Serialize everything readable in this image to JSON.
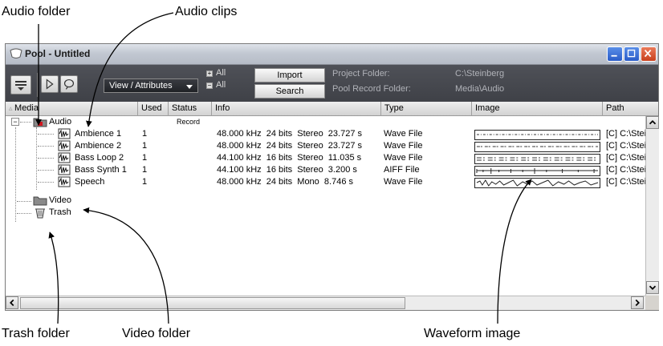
{
  "callouts": {
    "audio_folder": "Audio folder",
    "audio_clips": "Audio clips",
    "trash_folder": "Trash folder",
    "video_folder": "Video folder",
    "waveform_image": "Waveform image"
  },
  "window": {
    "title": "Pool - Untitled",
    "toolbar": {
      "view_dropdown": "View / Attributes",
      "all_1": "All",
      "all_2": "All",
      "import": "Import",
      "search": "Search",
      "project_folder_label": "Project Folder:",
      "project_folder_value": "C:\\Steinberg",
      "pool_record_label": "Pool Record Folder:",
      "pool_record_value": "Media\\Audio"
    },
    "columns": {
      "media": "Media",
      "used": "Used",
      "status": "Status",
      "info": "Info",
      "type": "Type",
      "image": "Image",
      "path": "Path"
    },
    "audio_folder": {
      "name": "Audio",
      "status": "Record"
    },
    "clips": [
      {
        "name": "Ambience 1",
        "used": "1",
        "info": "48.000 kHz  24 bits  Stereo  23.727 s",
        "type": "Wave File",
        "path": "[C] C:\\Stei"
      },
      {
        "name": "Ambience 2",
        "used": "1",
        "info": "48.000 kHz  24 bits  Stereo  23.727 s",
        "type": "Wave File",
        "path": "[C] C:\\Stei"
      },
      {
        "name": "Bass Loop 2",
        "used": "1",
        "info": "44.100 kHz  16 bits  Stereo  11.035 s",
        "type": "Wave File",
        "path": "[C] C:\\Stei"
      },
      {
        "name": "Bass Synth 1",
        "used": "1",
        "info": "44.100 kHz  16 bits  Stereo  3.200 s",
        "type": "AIFF File",
        "path": "[C] C:\\Stei"
      },
      {
        "name": "Speech",
        "used": "1",
        "info": "48.000 kHz  24 bits  Mono  8.746 s",
        "type": "Wave File",
        "path": "[C] C:\\Stei"
      }
    ],
    "video_folder": "Video",
    "trash_folder": "Trash"
  }
}
